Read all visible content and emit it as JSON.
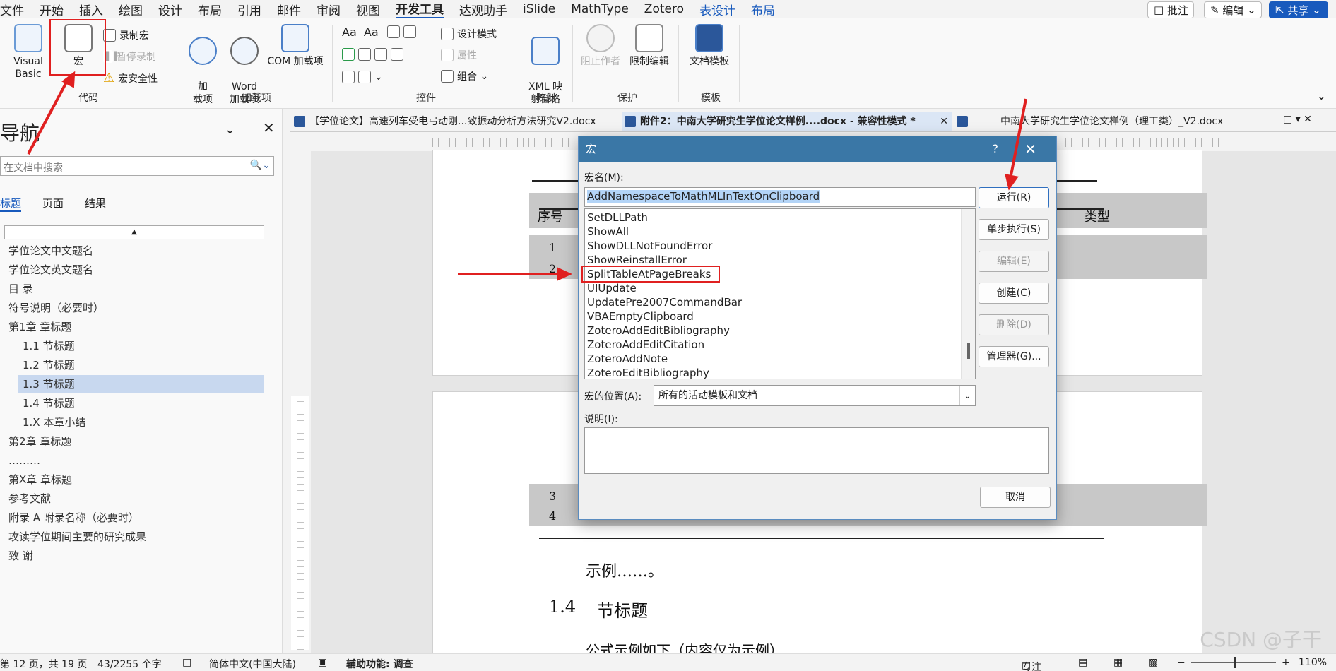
{
  "menu": {
    "items": [
      "文件",
      "开始",
      "插入",
      "绘图",
      "设计",
      "布局",
      "引用",
      "邮件",
      "审阅",
      "视图",
      "开发工具",
      "达观助手",
      "iSlide",
      "MathType",
      "Zotero",
      "表设计",
      "布局"
    ],
    "active": "开发工具",
    "comment_label": "批注",
    "edit_label": "编辑",
    "share_label": "共享"
  },
  "ribbon": {
    "code": {
      "visual_basic": "Visual Basic",
      "macros": "宏",
      "record_macro": "录制宏",
      "pause_record": "暂停录制",
      "macro_security": "宏安全性",
      "label": "代码"
    },
    "addins": {
      "addins": "加\n载项",
      "word_addins": "Word\n加载项",
      "com_addins": "COM 加载项",
      "label": "加载项"
    },
    "controls": {
      "design_mode": "设计模式",
      "properties": "属性",
      "group": "组合",
      "label": "控件"
    },
    "mapping": {
      "xml_pane": "XML 映\n射窗格",
      "label": "映射"
    },
    "protect": {
      "block_authors": "阻止作者",
      "restrict_editing": "限制编辑",
      "label": "保护"
    },
    "templates": {
      "doc_template": "文档模板",
      "label": "模板"
    }
  },
  "nav": {
    "title": "导航",
    "search_placeholder": "在文档中搜索",
    "tabs": [
      "标题",
      "页面",
      "结果"
    ],
    "items": [
      "学位论文中文题名",
      "学位论文英文题名",
      "目  录",
      "符号说明（必要时）",
      "第1章 章标题",
      "1.1 节标题",
      "1.2 节标题",
      "1.3 节标题",
      "1.4 节标题",
      "1.X 本章小结",
      "第2章 章标题",
      "………",
      "第X章 章标题",
      "参考文献",
      "附录 A  附录名称（必要时）",
      "攻读学位期间主要的研究成果",
      "致  谢"
    ]
  },
  "doc_tabs": [
    "【学位论文】高速列车受电弓动刚...致振动分析方法研究V2.docx",
    "附件2：中南大学研究生学位论文样例....docx  -  兼容性模式 *",
    "中南大学研究生学位论文样例（理工类）_V2.docx"
  ],
  "document": {
    "col_seq": "序号",
    "col_type": "类型",
    "rows": [
      "1",
      "2",
      "3",
      "4"
    ],
    "example_text": "示例……。",
    "heading_num": "1.4",
    "heading_text": "节标题",
    "formula_text": "公式示例如下（内容仅为示例）"
  },
  "dialog": {
    "title": "宏",
    "help": "?",
    "name_label": "宏名(M):",
    "name_value": "AddNamespaceToMathMLInTextOnClipboard",
    "macros": [
      "SetDLLPath",
      "ShowAll",
      "ShowDLLNotFoundError",
      "ShowReinstallError",
      "SplitTableAtPageBreaks",
      "UIUpdate",
      "UpdatePre2007CommandBar",
      "VBAEmptyClipboard",
      "ZoteroAddEditBibliography",
      "ZoteroAddEditCitation",
      "ZoteroAddNote",
      "ZoteroEditBibliography"
    ],
    "buttons": {
      "run": "运行(R)",
      "step": "单步执行(S)",
      "edit": "编辑(E)",
      "create": "创建(C)",
      "delete": "删除(D)",
      "organizer": "管理器(G)...",
      "cancel": "取消"
    },
    "location_label": "宏的位置(A):",
    "location_value": "所有的活动模板和文档",
    "desc_label": "说明(I):"
  },
  "status": {
    "page": "第 12 页，共 19 页",
    "words": "43/2255 个字",
    "lang": "简体中文(中国大陆)",
    "accessibility": "辅助功能: 调查",
    "focus": "专注",
    "zoom": "110%"
  },
  "watermark": "CSDN @子干"
}
